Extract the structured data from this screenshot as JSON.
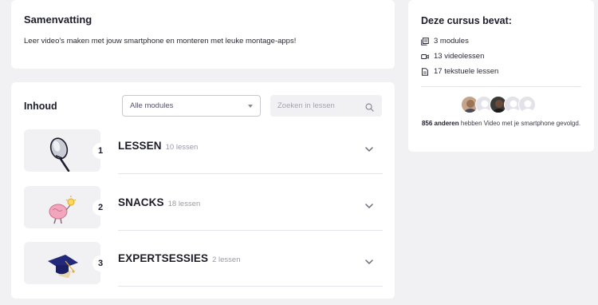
{
  "summary": {
    "title": "Samenvatting",
    "text": "Leer video's maken met jouw smartphone en monteren met leuke montage-apps!"
  },
  "contents": {
    "title": "Inhoud",
    "filter_value": "Alle modules",
    "search_placeholder": "Zoeken in lessen",
    "modules": [
      {
        "number": "1",
        "title": "LESSEN",
        "count": "10 lessen",
        "icon": "microphone-illustration"
      },
      {
        "number": "2",
        "title": "SNACKS",
        "count": "18 lessen",
        "icon": "brain-lightbulb-illustration"
      },
      {
        "number": "3",
        "title": "EXPERTSESSIES",
        "count": "2 lessen",
        "icon": "graduation-cap-illustration"
      }
    ]
  },
  "sidebar": {
    "title": "Deze cursus bevat:",
    "features": [
      {
        "icon": "modules-icon",
        "label": "3 modules"
      },
      {
        "icon": "video-camera-icon",
        "label": "13 videolessen"
      },
      {
        "icon": "document-icon",
        "label": "17 tekstuele lessen"
      }
    ],
    "followers_count": "856 anderen",
    "followers_text": " hebben Video met je smartphone gevolgd."
  },
  "colors": {
    "background": "#f1f1f4",
    "card": "#ffffff",
    "text": "#1d1d2b",
    "muted": "#9a9aa8"
  }
}
